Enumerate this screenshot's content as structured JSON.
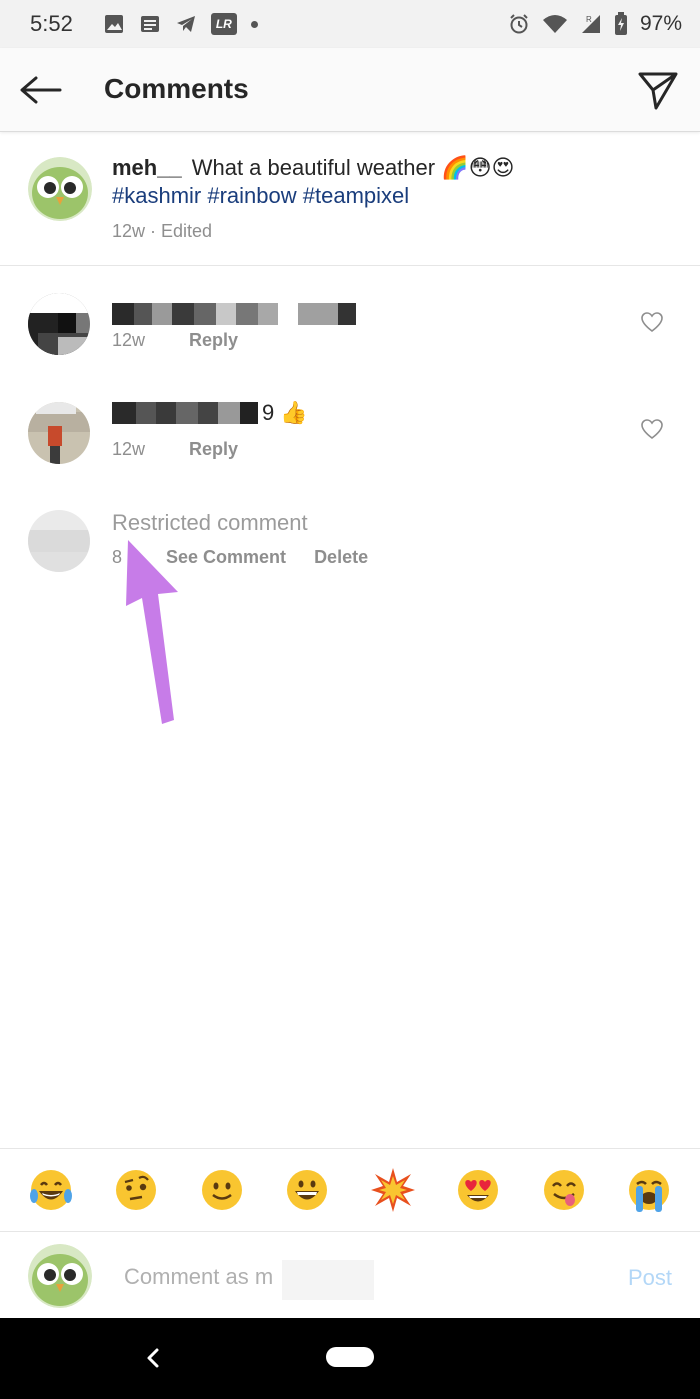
{
  "status_bar": {
    "time": "5:52",
    "lr_badge": "LR",
    "battery": "97%",
    "signal_label": "R"
  },
  "header": {
    "title": "Comments",
    "back_icon": "arrow-left-icon",
    "send_icon": "paper-plane-icon"
  },
  "caption": {
    "username": "meh__",
    "text": "What a beautiful weather 🌈😳😍",
    "hashtags": "#kashmir #rainbow #teampixel",
    "meta": "12w · Edited"
  },
  "comments": [
    {
      "time": "12w",
      "reply_label": "Reply",
      "suffix": ""
    },
    {
      "time": "12w",
      "reply_label": "Reply",
      "suffix": "9 👍"
    }
  ],
  "restricted": {
    "text": "Restricted comment",
    "time_partial": "8",
    "see_label": "See Comment",
    "delete_label": "Delete"
  },
  "emoji_bar": [
    "😂",
    "🤨",
    "🙂",
    "😀",
    "💥",
    "😍",
    "😋",
    "😭"
  ],
  "composer": {
    "placeholder": "Comment as m",
    "post_label": "Post"
  },
  "colors": {
    "hashtag": "#1a3d7c",
    "post_disabled": "#b3d7f7",
    "annotation_arrow": "#c77ce8"
  }
}
